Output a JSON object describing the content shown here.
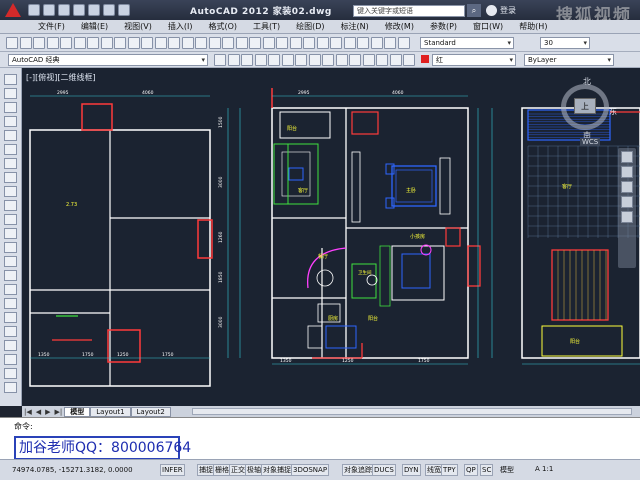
{
  "window": {
    "title": "AutoCAD 2012   家装02.dwg",
    "search_placeholder": "键入关键字或短语",
    "login": "登录",
    "watermark": "搜狐视频",
    "watermark_sub": "tv.sohu.com"
  },
  "menu": [
    "文件(F)",
    "编辑(E)",
    "视图(V)",
    "插入(I)",
    "格式(O)",
    "工具(T)",
    "绘图(D)",
    "标注(N)",
    "修改(M)",
    "参数(P)",
    "窗口(W)",
    "帮助(H)"
  ],
  "toolbar": {
    "workspace": "AutoCAD 经典",
    "text_style": "Standard",
    "text_height": "30",
    "layer_color": "红",
    "linetype": "ByLayer",
    "lineweight": "ByLayer"
  },
  "viewport": {
    "label": "[-][俯视][二维线框]",
    "viewcube": {
      "north": "北",
      "south": "南",
      "east": "东",
      "top": "上",
      "wcs": "WCS"
    }
  },
  "drawing": {
    "room_labels": [
      "阳台",
      "客厅",
      "主卧",
      "餐厅",
      "厨房",
      "卫生间",
      "小孩房",
      "阳台",
      "客厅",
      "阳台"
    ],
    "dims_top": [
      "2995",
      "4060",
      "2995",
      "4060"
    ],
    "dims_bottom": [
      "1350",
      "1750",
      "1250",
      "1750",
      "1350",
      "1250",
      "1750"
    ],
    "dims_left": [
      "1500",
      "3000",
      "1260",
      "1850",
      "3000"
    ],
    "accent_colors": {
      "wall": "#ffffff",
      "dimension": "#36c8d8",
      "door": "#ff3b3b",
      "furniture": "#3fe03f",
      "bed": "#2e66ff",
      "room_label": "#ffff3a",
      "lamp": "#ff40ff"
    }
  },
  "tabs": {
    "items": [
      "模型",
      "Layout1",
      "Layout2"
    ],
    "active": 0
  },
  "command": {
    "prompt": "命令:",
    "overlay": "加谷老师QQ：800006764"
  },
  "status": {
    "coords": "74974.0785, -15271.3182, 0.0000",
    "buttons": [
      "INFER",
      "捕捉",
      "栅格",
      "正交",
      "极轴",
      "对象捕捉",
      "3DOSNAP",
      "对象追踪",
      "DUCS",
      "DYN",
      "线宽",
      "TPY",
      "QP",
      "SC"
    ],
    "model": "模型",
    "scale": "A 1:1"
  }
}
